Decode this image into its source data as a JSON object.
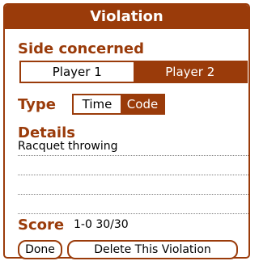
{
  "dialog": {
    "title": "Violation"
  },
  "side": {
    "label": "Side concerned",
    "options": [
      "Player 1",
      "Player 2"
    ],
    "selected": "Player 2"
  },
  "type": {
    "label": "Type",
    "options": [
      "Time",
      "Code"
    ],
    "selected": "Code"
  },
  "details": {
    "label": "Details",
    "lines": [
      "Racquet throwing",
      "",
      "",
      ""
    ]
  },
  "score": {
    "label": "Score",
    "value": "1-0  30/30"
  },
  "buttons": {
    "done": "Done",
    "delete": "Delete This Violation"
  },
  "colors": {
    "accent": "#9a3b0a"
  }
}
